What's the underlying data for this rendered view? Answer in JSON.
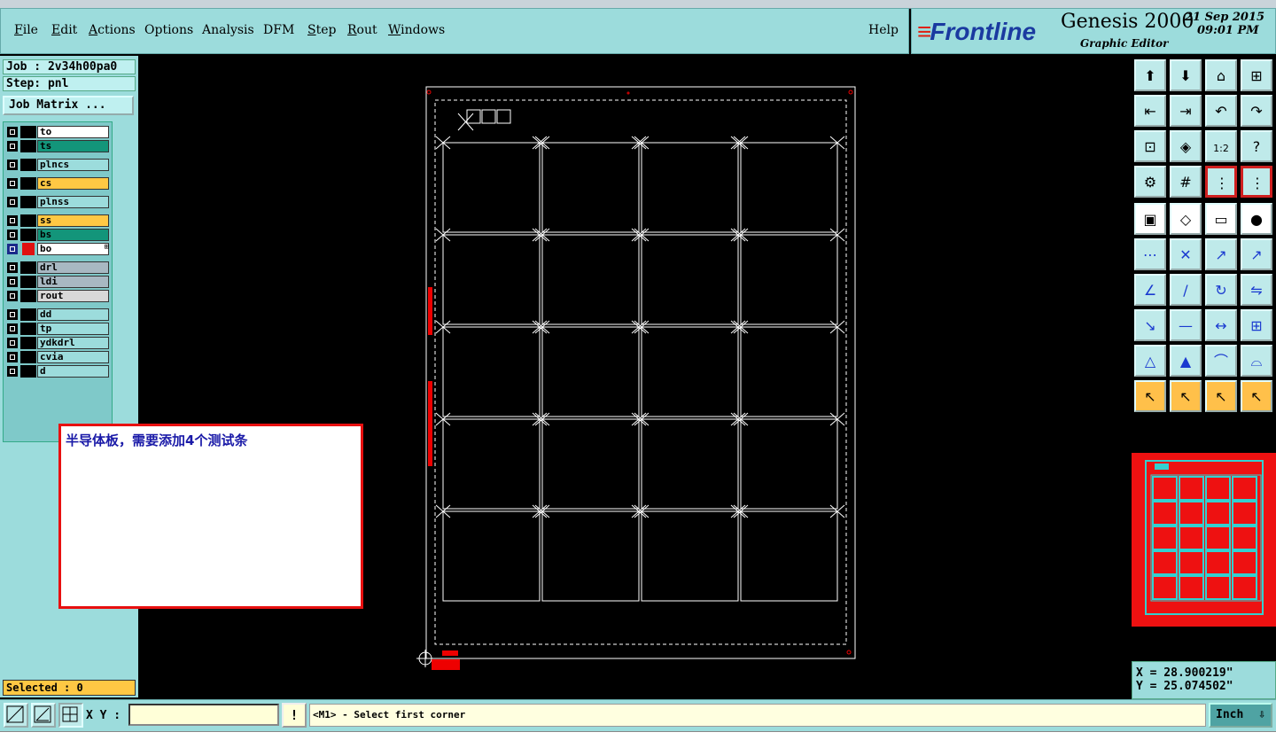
{
  "menubar": {
    "items": [
      "File",
      "Edit",
      "Actions",
      "Options",
      "Analysis",
      "DFM",
      "Step",
      "Rout",
      "Windows"
    ],
    "help": "Help"
  },
  "brand": {
    "logo": "Frontline",
    "app": "Genesis 2000",
    "subtitle": "Graphic Editor",
    "date": "21 Sep 2015",
    "time": "09:01 PM"
  },
  "job": {
    "job_line": "Job : 2v34h00pa0",
    "step_line": "Step: pnl",
    "matrix_button": "Job Matrix ..."
  },
  "layers": [
    {
      "name": "to",
      "color": "#ffffff"
    },
    {
      "name": "ts",
      "color": "#13957a"
    },
    {
      "name": "plncs",
      "color": "#9cdcdc"
    },
    {
      "name": "cs",
      "color": "#ffc844"
    },
    {
      "name": "plnss",
      "color": "#9cdcdc"
    },
    {
      "name": "ss",
      "color": "#ffc844"
    },
    {
      "name": "bs",
      "color": "#13957a"
    },
    {
      "name": "bo",
      "color": "#ffffff",
      "active": true
    },
    {
      "name": "drl",
      "color": "#a8b8c2"
    },
    {
      "name": "ldi",
      "color": "#a8b8c2"
    },
    {
      "name": "rout",
      "color": "#d8d8d8"
    },
    {
      "name": "dd",
      "color": "#9cdcdc"
    },
    {
      "name": "tp",
      "color": "#9cdcdc"
    },
    {
      "name": "ydkdrl",
      "color": "#9cdcdc"
    },
    {
      "name": "cvia",
      "color": "#9cdcdc"
    },
    {
      "name": "d",
      "color": "#9cdcdc"
    }
  ],
  "selected": "Selected : 0",
  "annotation": {
    "text": "半导体板，需要添加4个测试条"
  },
  "coords": {
    "x": "X = 28.900219\"",
    "y": "Y = 25.074502\""
  },
  "bottombar": {
    "xy_label": "X Y :",
    "xy_value": "",
    "warn": "!",
    "message": "<M1> - Select first corner",
    "units": "Inch"
  },
  "colors": {
    "panel": "#9cdcdc",
    "highlight": "#ffc844",
    "overview": "#ee1111",
    "overview_lines": "#33d0d0"
  }
}
